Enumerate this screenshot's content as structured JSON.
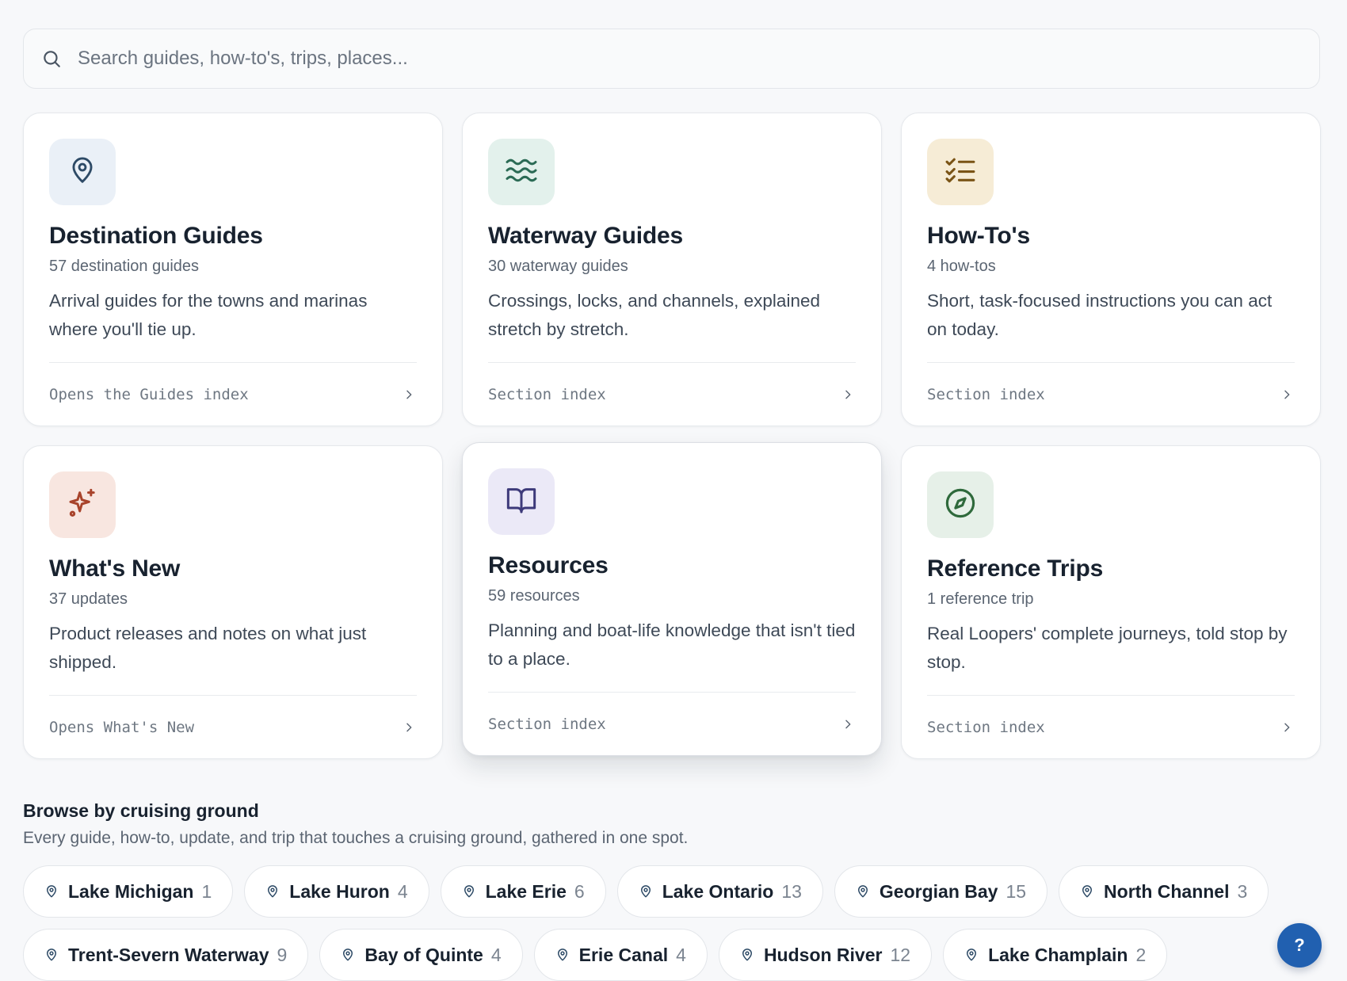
{
  "search": {
    "placeholder": "Search guides, how-to's, trips, places..."
  },
  "cards": [
    {
      "title": "Destination Guides",
      "count": "57 destination guides",
      "description": "Arrival guides for the towns and marinas where you'll tie up.",
      "link": "Opens the Guides index",
      "icon": "map-pin-icon",
      "badge_color": "#eaf0f7",
      "icon_color": "#2d4a66"
    },
    {
      "title": "Waterway Guides",
      "count": "30 waterway guides",
      "description": "Crossings, locks, and channels, explained stretch by stretch.",
      "link": "Section index",
      "icon": "waves-icon",
      "badge_color": "#e3f1ec",
      "icon_color": "#2b6b55"
    },
    {
      "title": "How-To's",
      "count": "4 how-tos",
      "description": "Short, task-focused instructions you can act on today.",
      "link": "Section index",
      "icon": "checklist-icon",
      "badge_color": "#f6ecd6",
      "icon_color": "#7a5416"
    },
    {
      "title": "What's New",
      "count": "37 updates",
      "description": "Product releases and notes on what just shipped.",
      "link": "Opens What's New",
      "icon": "sparkles-icon",
      "badge_color": "#f8e6e0",
      "icon_color": "#a8432b"
    },
    {
      "title": "Resources",
      "count": "59 resources",
      "description": "Planning and boat-life knowledge that isn't tied to a place.",
      "link": "Section index",
      "icon": "book-icon",
      "badge_color": "#ebe9f7",
      "icon_color": "#3d3a7a"
    },
    {
      "title": "Reference Trips",
      "count": "1 reference trip",
      "description": "Real Loopers' complete journeys, told stop by stop.",
      "link": "Section index",
      "icon": "compass-icon",
      "badge_color": "#e6f0e8",
      "icon_color": "#2f6a3c"
    }
  ],
  "browse": {
    "title": "Browse by cruising ground",
    "subtitle": "Every guide, how-to, update, and trip that touches a cruising ground, gathered in one spot.",
    "chips": [
      {
        "name": "Lake Michigan",
        "count": "1"
      },
      {
        "name": "Lake Huron",
        "count": "4"
      },
      {
        "name": "Lake Erie",
        "count": "6"
      },
      {
        "name": "Lake Ontario",
        "count": "13"
      },
      {
        "name": "Georgian Bay",
        "count": "15"
      },
      {
        "name": "North Channel",
        "count": "3"
      },
      {
        "name": "Trent-Severn Waterway",
        "count": "9"
      },
      {
        "name": "Bay of Quinte",
        "count": "4"
      },
      {
        "name": "Erie Canal",
        "count": "4"
      },
      {
        "name": "Hudson River",
        "count": "12"
      },
      {
        "name": "Lake Champlain",
        "count": "2"
      }
    ]
  },
  "help": {
    "label": "?"
  }
}
